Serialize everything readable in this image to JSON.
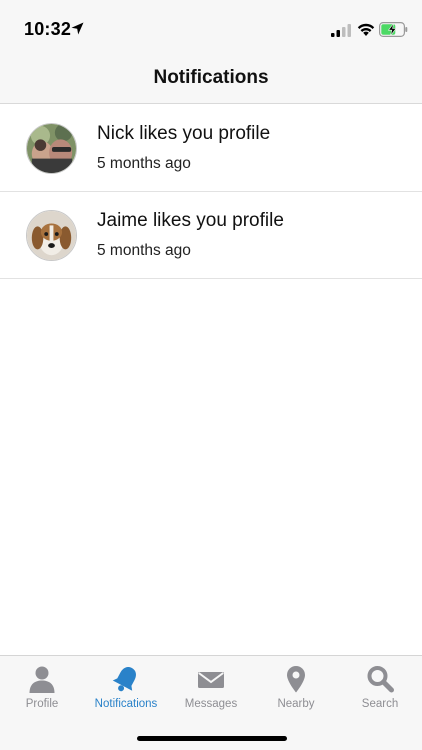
{
  "status_bar": {
    "time": "10:32",
    "icons": [
      "location-arrow-icon",
      "cellular-signal-icon",
      "wifi-icon",
      "battery-charging-icon"
    ]
  },
  "header": {
    "title": "Notifications"
  },
  "notifications": [
    {
      "title": "Nick likes you profile",
      "time": "5 months ago",
      "avatar": "photo-avatar"
    },
    {
      "title": "Jaime likes you profile",
      "time": "5 months ago",
      "avatar": "dog-photo-avatar"
    }
  ],
  "tab_bar": {
    "active": "Notifications",
    "tabs": [
      {
        "label": "Profile",
        "icon": "person-icon"
      },
      {
        "label": "Notifications",
        "icon": "bell-icon"
      },
      {
        "label": "Messages",
        "icon": "envelope-icon"
      },
      {
        "label": "Nearby",
        "icon": "map-pin-icon"
      },
      {
        "label": "Search",
        "icon": "magnifier-icon"
      }
    ]
  },
  "colors": {
    "accent": "#2a82c9",
    "inactive": "#8e8e93",
    "bar_background": "#f7f7f7"
  }
}
